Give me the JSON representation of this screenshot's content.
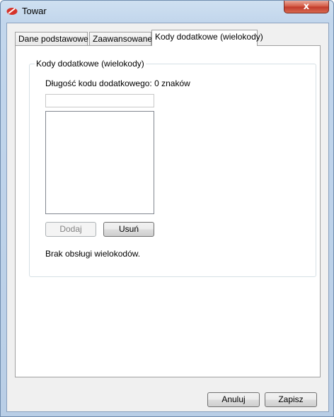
{
  "window": {
    "title": "Towar",
    "close_glyph": "x"
  },
  "tabs": [
    {
      "label": "Dane podstawowe"
    },
    {
      "label": "Zaawansowane"
    },
    {
      "label": "Kody dodatkowe (wielokody)",
      "active": true
    }
  ],
  "group": {
    "title": "Kody dodatkowe (wielokody)",
    "length_label": "Długość kodu dodatkowego: 0 znaków",
    "code_input": {
      "value": "",
      "placeholder": ""
    },
    "list_items": [],
    "add_label": "Dodaj",
    "remove_label": "Usuń",
    "status": "Brak obsługi wielokodów."
  },
  "footer": {
    "cancel_label": "Anuluj",
    "save_label": "Zapisz"
  },
  "colors": {
    "frame": "#c2d6ec",
    "client_bg": "#f0f0f0",
    "close_red": "#c0392b",
    "icon": "#d6332a"
  },
  "icons": {
    "app": "app-logo-icon",
    "close": "close-icon"
  }
}
